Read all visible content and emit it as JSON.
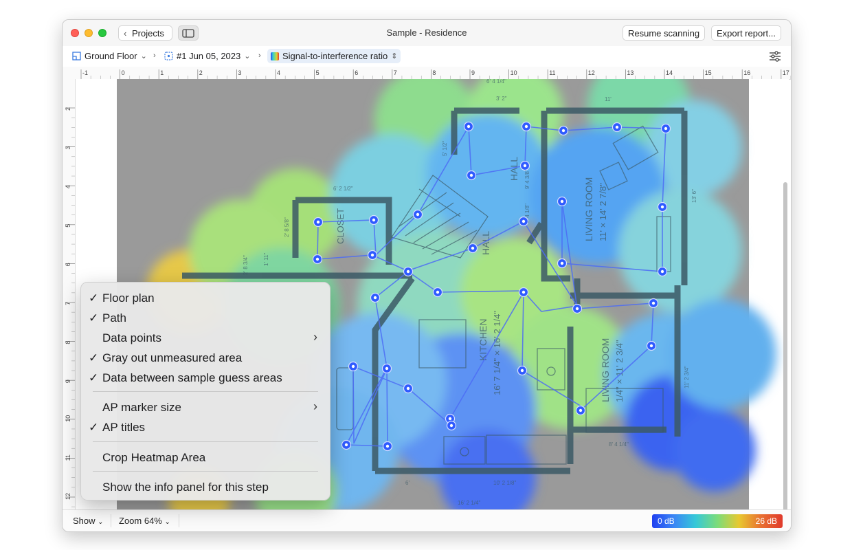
{
  "window": {
    "title": "Sample - Residence",
    "projects_label": "Projects",
    "resume_button": "Resume scanning",
    "export_button": "Export report..."
  },
  "breadcrumb": {
    "floor": "Ground Floor",
    "scan": "#1 Jun 05, 2023",
    "visualization": "Signal-to-interference ratio"
  },
  "ruler": {
    "top_ticks": [
      "-1",
      "0",
      "1",
      "2",
      "3",
      "4",
      "5",
      "6",
      "7",
      "8",
      "9",
      "10",
      "11",
      "12",
      "13",
      "14",
      "15",
      "16",
      "17"
    ],
    "left_ticks": [
      "2",
      "3",
      "4",
      "5",
      "6",
      "7",
      "8",
      "9",
      "10",
      "11",
      "12"
    ]
  },
  "floorplan": {
    "rooms": [
      {
        "name": "HALL"
      },
      {
        "name": "HALL"
      },
      {
        "name": "CLOSET"
      },
      {
        "name": "LIVING ROOM",
        "size": "11' × 14' 2 7/8\""
      },
      {
        "name": "KITCHEN",
        "size": "16' 7 1/4\" × 16' 2 1/4\""
      },
      {
        "name": "LIVING ROOM",
        "size": "1/4\" × 11' 2 3/4\""
      }
    ],
    "dimensions": [
      "6' 4 1/4\"",
      "11'",
      "6' 2 1/2\"",
      "9' 4 3/8\"",
      "6' 4 1/8\"",
      "13' 6\"",
      "2' 8 5/8\"",
      "1' 11\"",
      "2' 8 3/4\"",
      "11' 2 3/4\"",
      "8' 4 1/4\"",
      "10' 2 1/8\"",
      "16' 2 1/4\"",
      "6'",
      "5' 1/2\"",
      "3' 2\""
    ]
  },
  "menu": {
    "items": [
      {
        "label": "Floor plan",
        "checked": true
      },
      {
        "label": "Path",
        "checked": true
      },
      {
        "label": "Data points",
        "checked": false,
        "submenu": true
      },
      {
        "label": "Gray out unmeasured area",
        "checked": true
      },
      {
        "label": "Data between sample guess areas",
        "checked": true
      },
      {
        "label": "AP marker size",
        "checked": false,
        "submenu": true
      },
      {
        "label": "AP titles",
        "checked": true
      },
      {
        "label": "Crop Heatmap Area",
        "checked": false
      },
      {
        "label": "Show the info panel for this step",
        "checked": false
      }
    ]
  },
  "bottom": {
    "show_label": "Show",
    "zoom_label": "Zoom 64%",
    "legend_min": "0 dB",
    "legend_max": "26 dB"
  },
  "colors": {
    "accent": "#2f5bff",
    "traffic_red": "#ff5f57",
    "traffic_yellow": "#febc2e",
    "traffic_green": "#28c840",
    "gray_area": "#9a9a9a"
  },
  "icons": [
    "chevron-left-icon",
    "sidebar-icon",
    "floor-icon",
    "scan-icon",
    "rainbow-icon",
    "sliders-icon",
    "checkmark-icon",
    "chevron-right-icon",
    "chevron-down-icon"
  ]
}
